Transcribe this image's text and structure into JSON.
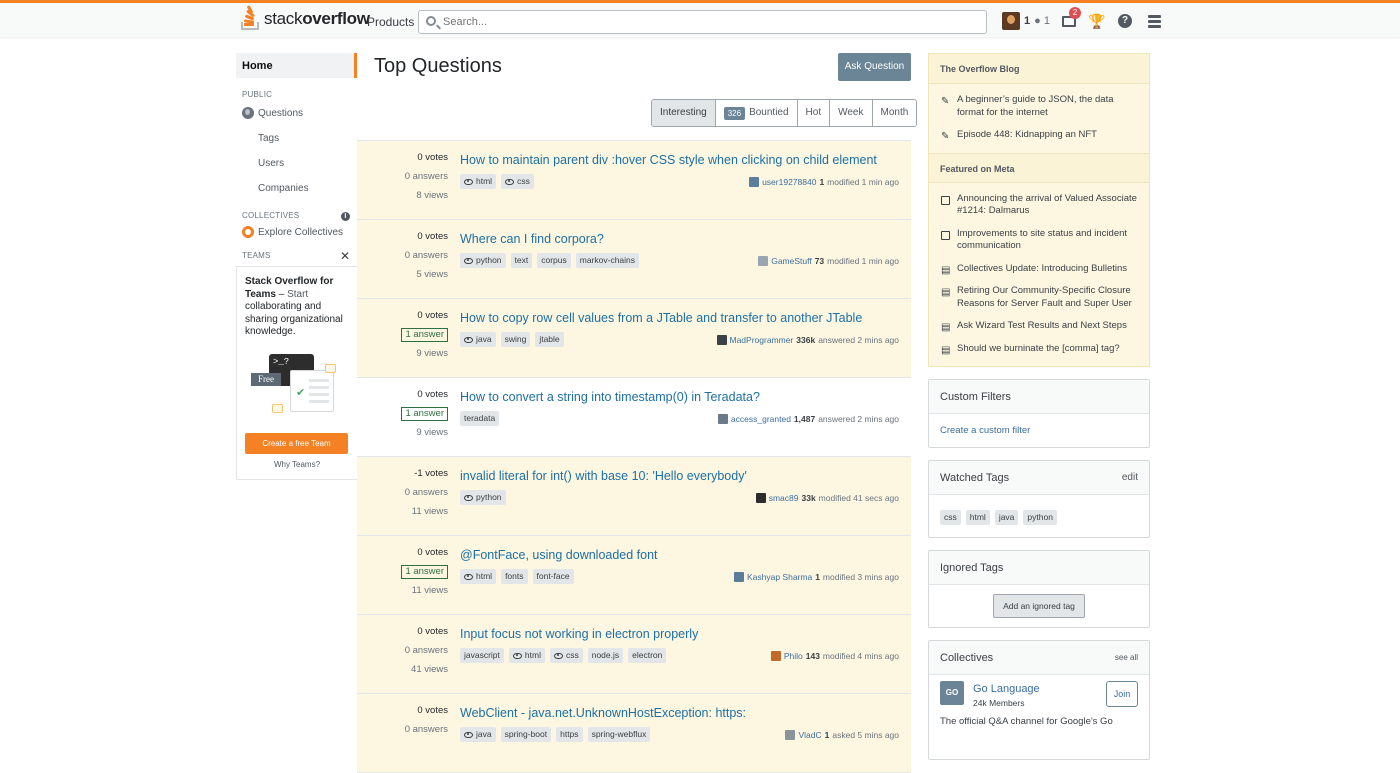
{
  "topbar": {
    "logo_text_light": "stack",
    "logo_text_bold": "overflow",
    "products_label": "Products",
    "search_placeholder": "Search...",
    "user_rep": "1",
    "user_badges": "● 1",
    "inbox_count": "2",
    "help_glyph": "?"
  },
  "sidebar": {
    "home": "Home",
    "public_header": "PUBLIC",
    "items": [
      "Questions",
      "Tags",
      "Users",
      "Companies"
    ],
    "collectives_header": "COLLECTIVES",
    "explore_collectives": "Explore Collectives",
    "teams_header": "TEAMS",
    "teams_card": {
      "title": "Stack Overflow for Teams",
      "dash": " – ",
      "start": "Start",
      "body": " collaborating and sharing organizational knowledge.",
      "free_label": "Free",
      "terminal": ">_?",
      "cta": "Create a free Team",
      "why": "Why Teams?"
    }
  },
  "main": {
    "title": "Top Questions",
    "ask_button": "Ask Question",
    "filters": {
      "interesting": "Interesting",
      "bountied_count": "326",
      "bountied": "Bountied",
      "hot": "Hot",
      "week": "Week",
      "month": "Month"
    },
    "questions": [
      {
        "votes": "0 votes",
        "answers": "0 answers",
        "answered": false,
        "views": "8 views",
        "title": "How to maintain parent div :hover CSS style when clicking on child element",
        "tags": [
          {
            "name": "html",
            "watched": true
          },
          {
            "name": "css",
            "watched": true
          }
        ],
        "user": "user19278840",
        "rep": "1",
        "action": "modified 1 min ago",
        "highlight": true,
        "avatar_color": "#5b7e9a"
      },
      {
        "votes": "0 votes",
        "answers": "0 answers",
        "answered": false,
        "views": "5 views",
        "title": "Where can I find corpora?",
        "tags": [
          {
            "name": "python",
            "watched": true
          },
          {
            "name": "text",
            "watched": false
          },
          {
            "name": "corpus",
            "watched": false
          },
          {
            "name": "markov-chains",
            "watched": false
          }
        ],
        "user": "GameStuff",
        "rep": "73",
        "action": "modified 1 min ago",
        "highlight": true,
        "avatar_color": "#9aa7b0"
      },
      {
        "votes": "0 votes",
        "answers": "1 answer",
        "answered": true,
        "views": "9 views",
        "title": "How to copy row cell values from a JTable and transfer to another JTable",
        "tags": [
          {
            "name": "java",
            "watched": true
          },
          {
            "name": "swing",
            "watched": false
          },
          {
            "name": "jtable",
            "watched": false
          }
        ],
        "user": "MadProgrammer",
        "rep": "336k",
        "action": "answered 2 mins ago",
        "highlight": true,
        "avatar_color": "#3b4045"
      },
      {
        "votes": "0 votes",
        "answers": "1 answer",
        "answered": true,
        "views": "9 views",
        "title": "How to convert a string into timestamp(0) in Teradata?",
        "tags": [
          {
            "name": "teradata",
            "watched": false
          }
        ],
        "user": "access_granted",
        "rep": "1,487",
        "action": "answered 2 mins ago",
        "highlight": false,
        "avatar_color": "#6b7a86"
      },
      {
        "votes": "-1 votes",
        "answers": "0 answers",
        "answered": false,
        "views": "11 views",
        "title": "invalid literal for int() with base 10: 'Hello everybody'",
        "tags": [
          {
            "name": "python",
            "watched": true
          }
        ],
        "user": "smac89",
        "rep": "33k",
        "action": "modified 41 secs ago",
        "highlight": true,
        "avatar_color": "#2d2d2d"
      },
      {
        "votes": "0 votes",
        "answers": "1 answer",
        "answered": true,
        "views": "11 views",
        "title": "@FontFace, using downloaded font",
        "tags": [
          {
            "name": "html",
            "watched": true
          },
          {
            "name": "fonts",
            "watched": false
          },
          {
            "name": "font-face",
            "watched": false
          }
        ],
        "user": "Kashyap Sharma",
        "rep": "1",
        "action": "modified 3 mins ago",
        "highlight": true,
        "avatar_color": "#5b7e9a"
      },
      {
        "votes": "0 votes",
        "answers": "0 answers",
        "answered": false,
        "views": "41 views",
        "title": "Input focus not working in electron properly",
        "tags": [
          {
            "name": "javascript",
            "watched": false
          },
          {
            "name": "html",
            "watched": true
          },
          {
            "name": "css",
            "watched": true
          },
          {
            "name": "node.js",
            "watched": false
          },
          {
            "name": "electron",
            "watched": false
          }
        ],
        "user": "Philo",
        "rep": "143",
        "action": "modified 4 mins ago",
        "highlight": true,
        "avatar_color": "#c26b2b"
      },
      {
        "votes": "0 votes",
        "answers": "0 answers",
        "answered": false,
        "views": "",
        "title": "WebClient - java.net.UnknownHostException: https:",
        "tags": [
          {
            "name": "java",
            "watched": true
          },
          {
            "name": "spring-boot",
            "watched": false
          },
          {
            "name": "https",
            "watched": false
          },
          {
            "name": "spring-webflux",
            "watched": false
          }
        ],
        "user": "VladC",
        "rep": "1",
        "action": "asked 5 mins ago",
        "highlight": true,
        "avatar_color": "#8a949c"
      }
    ]
  },
  "right": {
    "blog": {
      "header": "The Overflow Blog",
      "posts": [
        "A beginner’s guide to JSON, the data format for the internet",
        "Episode 448: Kidnapping an NFT"
      ],
      "meta_header": "Featured on Meta",
      "meta_posts": [
        {
          "text": "Announcing the arrival of Valued Associate #1214: Dalmarus",
          "icon": "chat-icon"
        },
        {
          "text": "Improvements to site status and incident communication",
          "icon": "chat-icon"
        },
        {
          "text": "Collectives Update: Introducing Bulletins",
          "icon": "stack-icon"
        },
        {
          "text": "Retiring Our Community-Specific Closure Reasons for Server Fault and Super User",
          "icon": "stack-icon"
        },
        {
          "text": "Ask Wizard Test Results and Next Steps",
          "icon": "stack-icon"
        },
        {
          "text": "Should we burninate the [comma] tag?",
          "icon": "stack-icon"
        }
      ]
    },
    "custom_filters": {
      "header": "Custom Filters",
      "link": "Create a custom filter"
    },
    "watched_tags": {
      "header": "Watched Tags",
      "edit": "edit",
      "tags": [
        "css",
        "html",
        "java",
        "python"
      ]
    },
    "ignored_tags": {
      "header": "Ignored Tags",
      "button": "Add an ignored tag"
    },
    "collectives": {
      "header": "Collectives",
      "see_all": "see all",
      "name": "Go Language",
      "members": "24k Members",
      "join": "Join",
      "logo": "GO",
      "desc": "The official Q&A channel for Google's Go"
    }
  },
  "colors": {
    "accent": "#f48225",
    "highlight_row": "#fdf7e2",
    "link": "#1d6fa5",
    "ask_button": "#6b8596"
  }
}
